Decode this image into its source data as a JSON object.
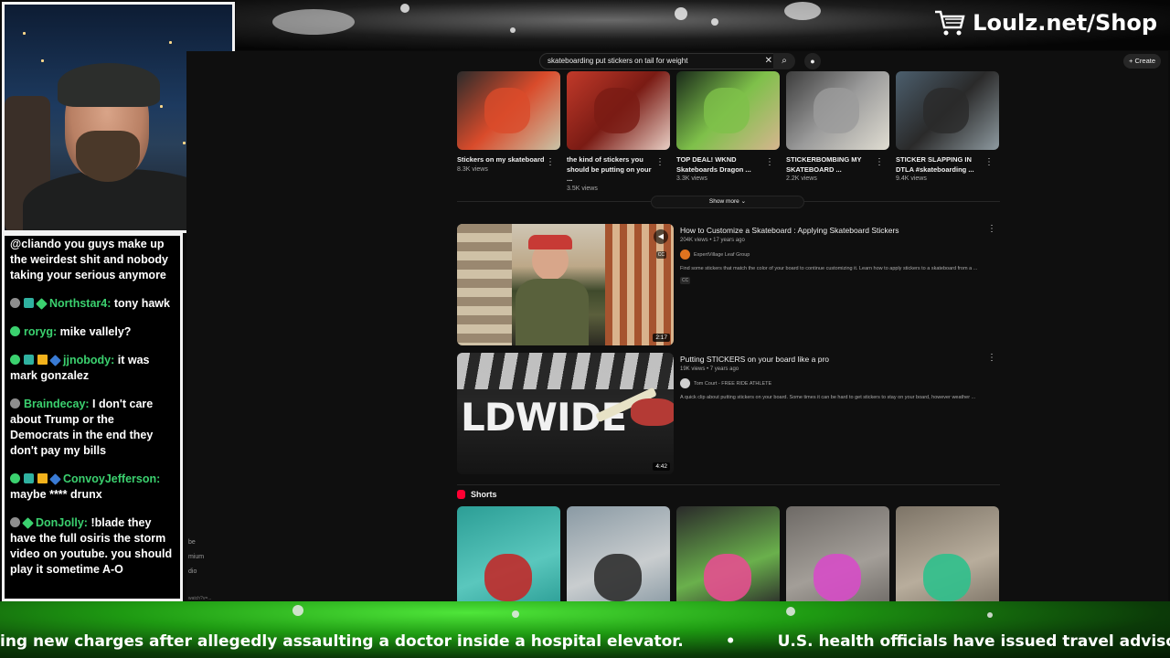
{
  "banner": {
    "shop_label": "Loulz.net/Shop",
    "cart_icon": "cart-icon"
  },
  "chat": {
    "messages": [
      {
        "user": "",
        "text": "@cliando you guys make up the weirdest shit and nobody taking your serious anymore",
        "color": "#ffffff",
        "badges": []
      },
      {
        "user": "Northstar4:",
        "text": "tony hawk",
        "color": "#3bd16f",
        "badges": [
          "b-grey",
          "b-sq",
          "b-diamond"
        ]
      },
      {
        "user": "roryg:",
        "text": "mike vallely?",
        "color": "#3bd16f",
        "badges": [
          "b-green"
        ]
      },
      {
        "user": "jjnobody:",
        "text": "it was mark gonzalez",
        "color": "#3bd16f",
        "badges": [
          "b-green",
          "b-sq",
          "b-gold",
          "b-blue"
        ]
      },
      {
        "user": "Braindecay:",
        "text": "I don't care about Trump or the Democrats in the end they don't pay my bills",
        "color": "#3bd16f",
        "badges": [
          "b-grey"
        ]
      },
      {
        "user": "ConvoyJefferson:",
        "text": "maybe **** drunx",
        "color": "#3bd16f",
        "badges": [
          "b-green",
          "b-sq",
          "b-gold",
          "b-blue"
        ]
      },
      {
        "user": "DonJolly:",
        "text": "!blade they have the full osiris the storm video on youtube. you should play it sometime A-O",
        "color": "#3bd16f",
        "badges": [
          "b-grey",
          "b-diamond"
        ]
      }
    ]
  },
  "browser": {
    "search": {
      "query": "skateboarding put stickers on tail for weight"
    },
    "create_label": "Create",
    "rail_labels": [
      "be",
      "mium",
      "dio"
    ],
    "top_videos": [
      {
        "title": "Stickers on my skateboard",
        "views": "8.3K views",
        "colors": [
          "#2b2b2b",
          "#d94b2b",
          "#c9c4a8"
        ]
      },
      {
        "title": "the kind of stickers you should be putting on your ...",
        "views": "3.5K views",
        "colors": [
          "#c23a2a",
          "#7a1b14",
          "#e8cfc5"
        ]
      },
      {
        "title": "TOP DEAL! WKND Skateboards Dragon ...",
        "views": "3.3K views",
        "colors": [
          "#1a2a1a",
          "#7ec04a",
          "#d6b58f"
        ]
      },
      {
        "title": "STICKERBOMBING MY SKATEBOARD ...",
        "views": "2.2K views",
        "colors": [
          "#3c3c3c",
          "#9b9b9b",
          "#e0ddd2"
        ]
      },
      {
        "title": "STICKER SLAPPING IN DTLA #skateboarding ...",
        "views": "9.4K views",
        "colors": [
          "#4c5f6e",
          "#2a2a2a",
          "#8e9aa0"
        ]
      }
    ],
    "show_more": "Show more",
    "results": [
      {
        "title": "How to Customize a Skateboard : Applying Skateboard Stickers",
        "meta": "204K views • 17 years ago",
        "channel": "ExpertVillage Leaf Group",
        "desc": "Find some stickers that match the color of your board to continue customizing it. Learn how to apply stickers to a skateboard from a ...",
        "duration": "2:17",
        "cc": "CC",
        "avatar_color": "#e0731f"
      },
      {
        "title": "Putting STICKERS on your board like a pro",
        "meta": "19K views • 7 years ago",
        "channel": "Tom Court - FREE RIDE ATHLETE",
        "desc": "A quick clip about putting stickers on your board. Some times it can be hard to get stickers to stay on your board, however weather ...",
        "duration": "4:42",
        "avatar_color": "#cfcfcf"
      }
    ],
    "shorts_label": "Shorts",
    "shorts": [
      {
        "colors": [
          "#2c9e96",
          "#5ac7bd",
          "#c12a2a"
        ]
      },
      {
        "colors": [
          "#8a9aa4",
          "#c9cdcf",
          "#2f2f2f"
        ]
      },
      {
        "colors": [
          "#2a2a2a",
          "#6ab04c",
          "#e44f8f"
        ]
      },
      {
        "colors": [
          "#6e6a66",
          "#a39e98",
          "#d64cc7"
        ]
      },
      {
        "colors": [
          "#7d7467",
          "#b8ad9c",
          "#2fc08c"
        ]
      }
    ]
  },
  "ticker": {
    "items": [
      "ing new charges after allegedly assaulting a doctor inside a hospital elevator.",
      "U.S. health officials have issued travel advisories for Americans p"
    ],
    "separator": "•"
  }
}
